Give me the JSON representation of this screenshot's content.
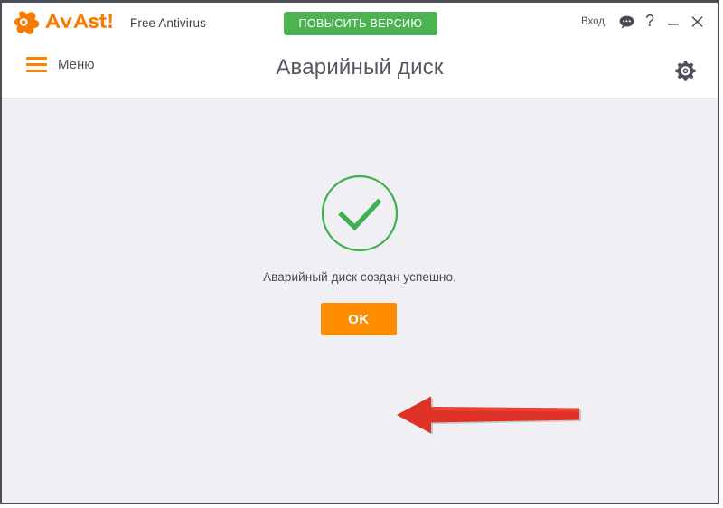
{
  "window": {
    "titlebar": {
      "brand_word": "avast!",
      "product_name": "Free Antivirus",
      "upgrade_label": "ПОВЫСИТЬ ВЕРСИЮ",
      "login_label": "Вход",
      "chat_icon": "speech-bubble-icon",
      "help_label": "?",
      "minimize_label": "—",
      "close_label": "✕"
    },
    "header": {
      "menu_label": "Меню",
      "menu_icon": "hamburger-icon",
      "page_title": "Аварийный диск",
      "settings_icon": "gear-icon"
    },
    "content": {
      "status_icon": "check-circle-icon",
      "status_message": "Аварийный диск создан успешно.",
      "ok_label": "OK",
      "annotation_icon": "red-left-arrow"
    },
    "colors": {
      "brand_orange": "#ff8000",
      "upgrade_green": "#4cb252",
      "success_green": "#3faf4f",
      "button_orange": "#ff8c00",
      "annotation_red": "#e03127",
      "content_background": "#f0f0f4",
      "frame_border": "#4b4f58"
    }
  }
}
